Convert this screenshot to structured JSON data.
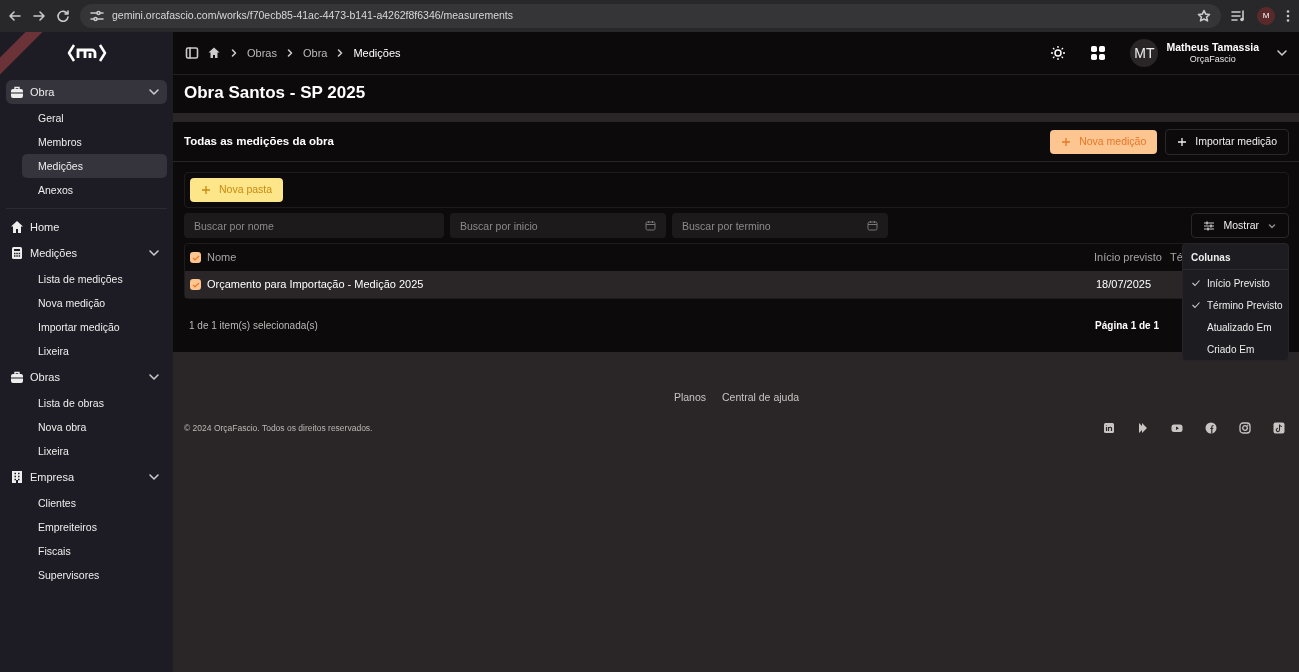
{
  "browser": {
    "url": "gemini.orcafascio.com/works/f70ecb85-41ac-4473-b141-a4262f8f6346/measurements",
    "profile_initial": "M"
  },
  "sidebar": {
    "groups": [
      {
        "label": "Obra",
        "selected": true,
        "expanded": true,
        "children": [
          {
            "label": "Geral",
            "selected": false
          },
          {
            "label": "Membros",
            "selected": false
          },
          {
            "label": "Medições",
            "selected": true
          },
          {
            "label": "Anexos",
            "selected": false
          }
        ]
      },
      {
        "label": "Home",
        "selected": false
      },
      {
        "label": "Medições",
        "selected": false,
        "expanded": true,
        "children": [
          {
            "label": "Lista de medições",
            "selected": false
          },
          {
            "label": "Nova medição",
            "selected": false
          },
          {
            "label": "Importar medição",
            "selected": false
          },
          {
            "label": "Lixeira",
            "selected": false
          }
        ]
      },
      {
        "label": "Obras",
        "selected": false,
        "expanded": true,
        "children": [
          {
            "label": "Lista de obras",
            "selected": false
          },
          {
            "label": "Nova obra",
            "selected": false
          },
          {
            "label": "Lixeira",
            "selected": false
          }
        ]
      },
      {
        "label": "Empresa",
        "selected": false,
        "expanded": true,
        "children": [
          {
            "label": "Clientes",
            "selected": false
          },
          {
            "label": "Empreiteiros",
            "selected": false
          },
          {
            "label": "Fiscais",
            "selected": false
          },
          {
            "label": "Supervisores",
            "selected": false
          }
        ]
      }
    ]
  },
  "breadcrumbs": [
    {
      "label": "Obras",
      "current": false
    },
    {
      "label": "Obra",
      "current": false
    },
    {
      "label": "Medições",
      "current": true
    }
  ],
  "user": {
    "initials": "MT",
    "name": "Matheus Tamassia",
    "org": "OrçaFascio"
  },
  "page_title": "Obra Santos - SP 2025",
  "card": {
    "title": "Todas as medições da obra",
    "buttons": [
      {
        "label": "Nova medição",
        "kind": "primary"
      },
      {
        "label": "Importar medição",
        "kind": "outline"
      }
    ],
    "folder_button": "Nova pasta",
    "filters": [
      {
        "placeholder": "Buscar por nome",
        "kind": "text"
      },
      {
        "placeholder": "Buscar por inicio",
        "kind": "date"
      },
      {
        "placeholder": "Buscar por termino",
        "kind": "date"
      }
    ],
    "show_button": "Mostrar",
    "table": {
      "all_checked": true,
      "columns": [
        "Nome",
        "Início previsto",
        "Té"
      ],
      "rows": [
        {
          "checked": true,
          "cells": [
            "Orçamento para Importação - Medição 2025",
            "18/07/2025"
          ]
        }
      ]
    },
    "selection_text": "1 de 1 item(s) selecionada(s)",
    "page_text": "Página 1 de 1",
    "columns_menu": {
      "title": "Colunas",
      "items": [
        {
          "label": "Início Previsto",
          "checked": true
        },
        {
          "label": "Término Previsto",
          "checked": true
        },
        {
          "label": "Atualizado Em",
          "checked": false
        },
        {
          "label": "Criado Em",
          "checked": false
        }
      ]
    }
  },
  "footer": {
    "links": [
      "Planos",
      "Central de ajuda"
    ],
    "copyright": "© 2024 OrçaFascio. Todos os direitos reservados."
  }
}
